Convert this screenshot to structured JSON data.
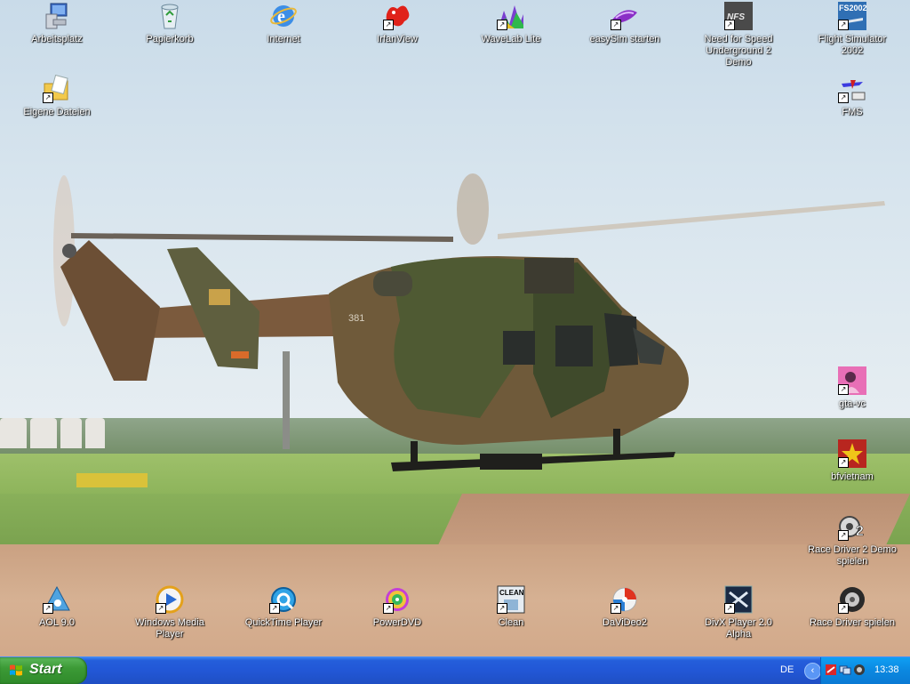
{
  "desktop": {
    "icons": [
      {
        "label": "Arbeitsplatz",
        "icon": "my-computer-icon"
      },
      {
        "label": "Papierkorb",
        "icon": "recycle-bin-icon"
      },
      {
        "label": "Internet",
        "icon": "internet-explorer-icon"
      },
      {
        "label": "IrfanView",
        "icon": "irfanview-icon"
      },
      {
        "label": "WaveLab Lite",
        "icon": "wavelab-icon"
      },
      {
        "label": "easySim starten",
        "icon": "easysim-icon"
      },
      {
        "label": "Need for Speed Underground 2 Demo",
        "icon": "nfs-icon"
      },
      {
        "label": "Flight Simulator 2002",
        "icon": "flight-simulator-icon"
      },
      {
        "label": "Eigene Dateien",
        "icon": "my-documents-icon"
      },
      {
        "label": "FMS",
        "icon": "fms-icon"
      },
      {
        "label": "gta-vc",
        "icon": "gta-vc-icon"
      },
      {
        "label": "bfvietnam",
        "icon": "bfvietnam-icon"
      },
      {
        "label": "Race Driver 2 Demo spielen",
        "icon": "race-driver-2-icon"
      },
      {
        "label": "AOL 9.0",
        "icon": "aol-icon"
      },
      {
        "label": "Windows Media Player",
        "icon": "media-player-icon"
      },
      {
        "label": "QuickTime Player",
        "icon": "quicktime-icon"
      },
      {
        "label": "PowerDVD",
        "icon": "powerdvd-icon"
      },
      {
        "label": "Clean",
        "icon": "clean-icon"
      },
      {
        "label": "DaViDeo2",
        "icon": "davideo-icon"
      },
      {
        "label": "DivX Player 2.0 Alpha",
        "icon": "divx-icon"
      },
      {
        "label": "Race Driver spielen",
        "icon": "race-driver-icon"
      }
    ],
    "icon_text": {
      "fs": "FS2002",
      "nfs": "NFS",
      "clean": "CLEAN",
      "rd2": "2"
    }
  },
  "wallpaper": {
    "tail_number": "381"
  },
  "taskbar": {
    "start_label": "Start",
    "language": "DE",
    "clock": "13:38"
  },
  "colors": {
    "taskbar": "#245edb",
    "start_button": "#3c9a36",
    "tray": "#0b88e0"
  }
}
